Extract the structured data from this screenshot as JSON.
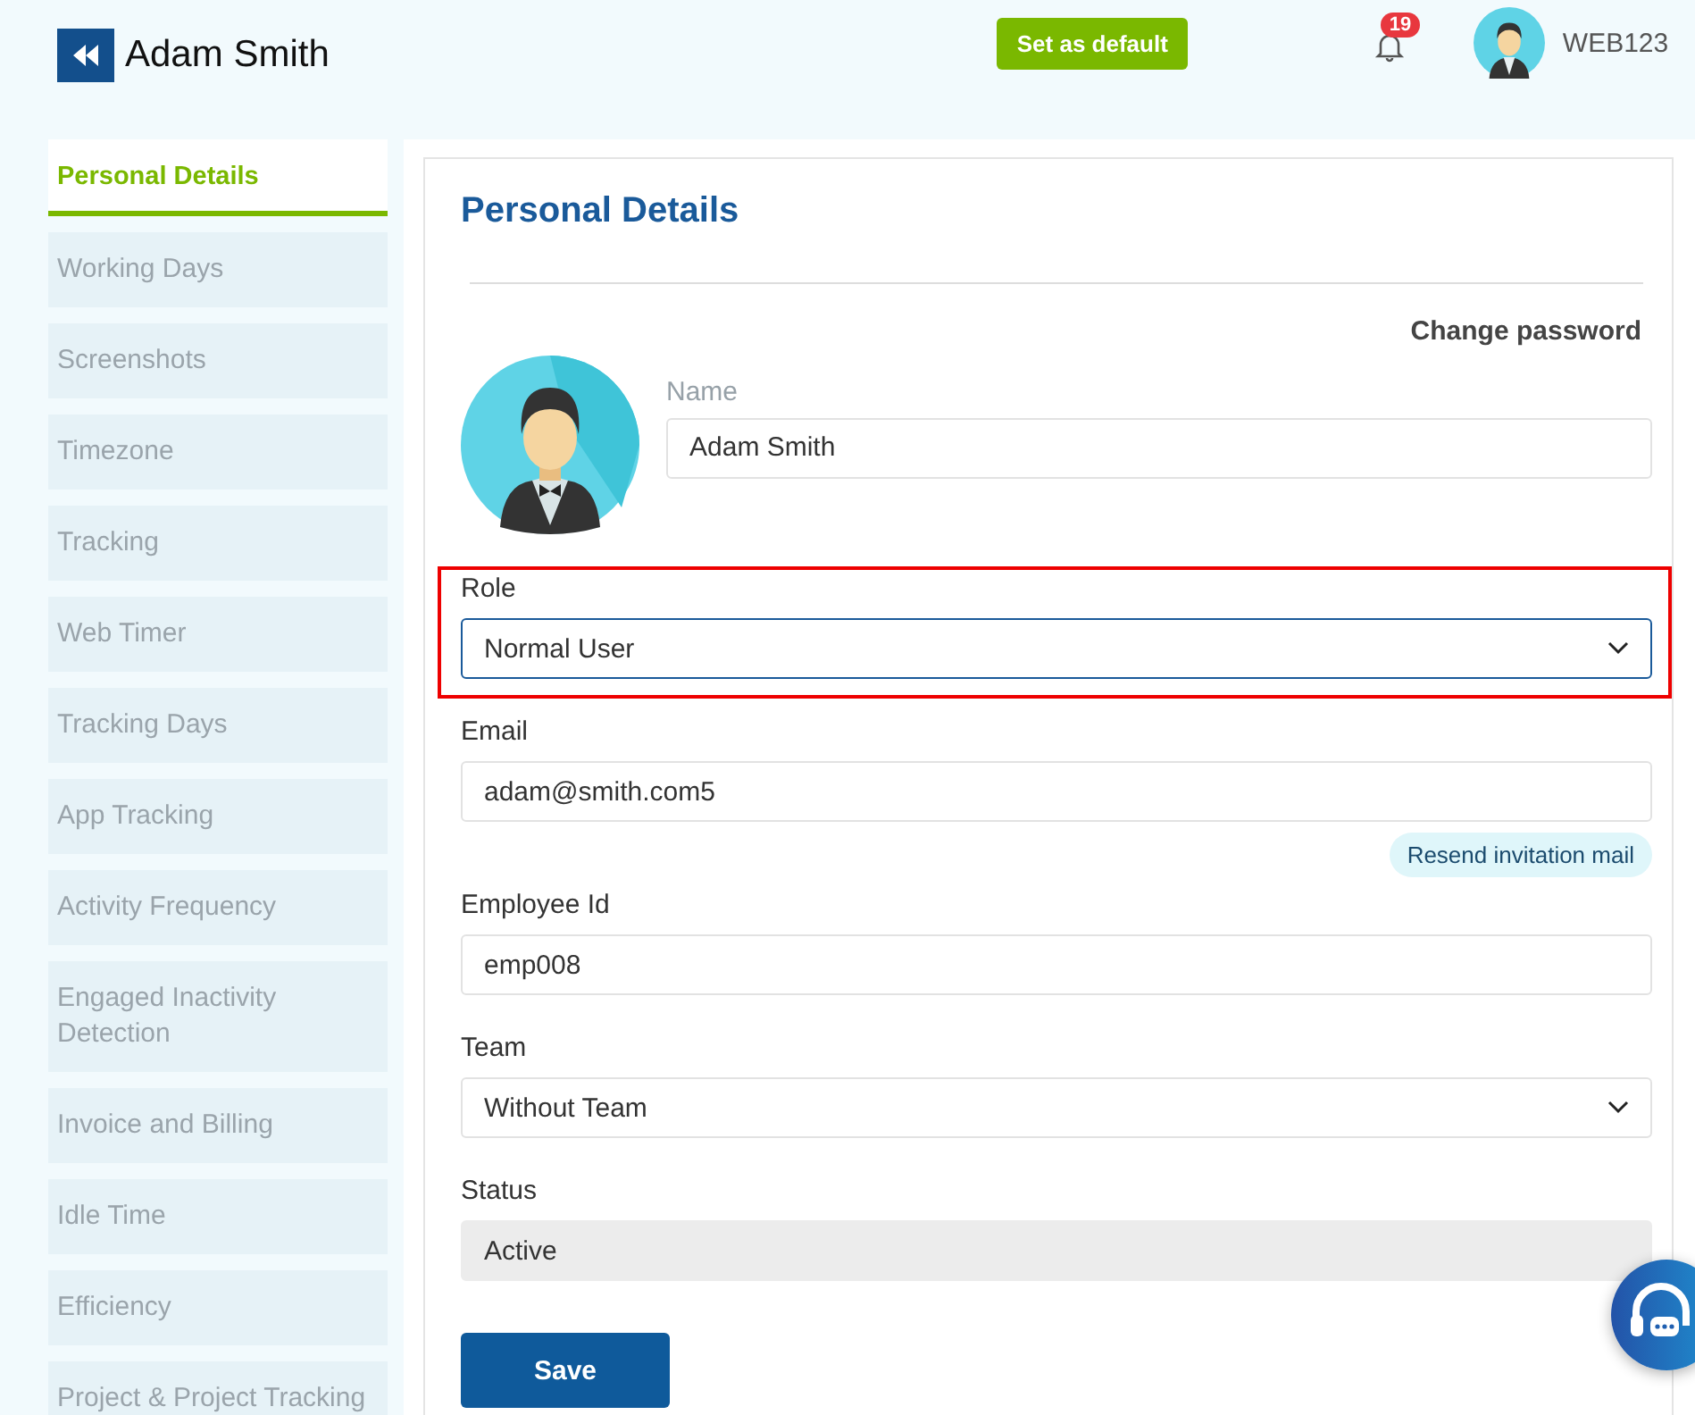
{
  "header": {
    "title": "Adam Smith",
    "default_button": "Set as default",
    "notification_count": "19",
    "account": "WEB123"
  },
  "sidebar": {
    "items": [
      {
        "label": "Personal Details",
        "selected": true
      },
      {
        "label": "Working Days",
        "selected": false
      },
      {
        "label": "Screenshots",
        "selected": false
      },
      {
        "label": "Timezone",
        "selected": false
      },
      {
        "label": "Tracking",
        "selected": false
      },
      {
        "label": "Web Timer",
        "selected": false
      },
      {
        "label": "Tracking Days",
        "selected": false
      },
      {
        "label": "App Tracking",
        "selected": false
      },
      {
        "label": "Activity Frequency",
        "selected": false
      },
      {
        "label": "Engaged Inactivity Detection",
        "selected": false
      },
      {
        "label": "Invoice and Billing",
        "selected": false
      },
      {
        "label": "Idle Time",
        "selected": false
      },
      {
        "label": "Efficiency",
        "selected": false
      },
      {
        "label": "Project & Project Tracking",
        "selected": false
      }
    ]
  },
  "panel": {
    "title": "Personal Details",
    "change_password": "Change password",
    "name_field": {
      "label": "Name",
      "value": "Adam Smith"
    },
    "fields": [
      {
        "kind": "select",
        "label": "Role",
        "value": "Normal User",
        "highlighted": true
      },
      {
        "kind": "text",
        "label": "Email",
        "value": "adam@smith.com5",
        "action": "Resend invitation mail"
      },
      {
        "kind": "text",
        "label": "Employee Id",
        "value": "emp008"
      },
      {
        "kind": "select",
        "label": "Team",
        "value": "Without Team",
        "highlighted": false
      },
      {
        "kind": "readonly",
        "label": "Status",
        "value": "Active"
      }
    ],
    "save_button": "Save"
  }
}
